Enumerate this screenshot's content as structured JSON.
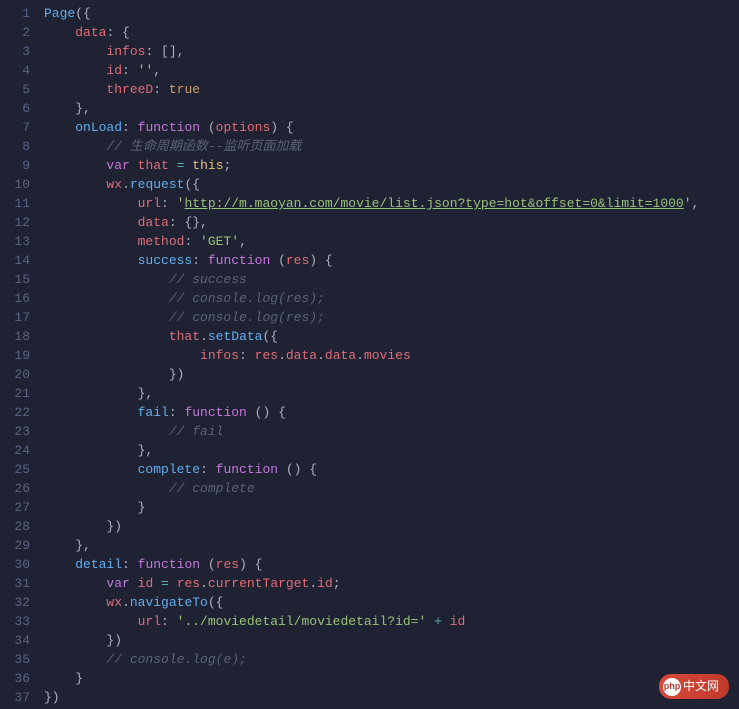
{
  "watermark": "中文网",
  "lines": [
    {
      "n": 1,
      "t": [
        {
          "c": "fn",
          "v": "Page"
        },
        {
          "c": "punc",
          "v": "({"
        }
      ]
    },
    {
      "n": 2,
      "t": [
        {
          "c": "",
          "v": "    "
        },
        {
          "c": "prop",
          "v": "data"
        },
        {
          "c": "punc",
          "v": ": {"
        }
      ]
    },
    {
      "n": 3,
      "t": [
        {
          "c": "",
          "v": "        "
        },
        {
          "c": "prop",
          "v": "infos"
        },
        {
          "c": "punc",
          "v": ": [],"
        }
      ]
    },
    {
      "n": 4,
      "t": [
        {
          "c": "",
          "v": "        "
        },
        {
          "c": "prop",
          "v": "id"
        },
        {
          "c": "punc",
          "v": ": "
        },
        {
          "c": "str",
          "v": "''"
        },
        {
          "c": "punc",
          "v": ","
        }
      ]
    },
    {
      "n": 5,
      "t": [
        {
          "c": "",
          "v": "        "
        },
        {
          "c": "prop",
          "v": "threeD"
        },
        {
          "c": "punc",
          "v": ": "
        },
        {
          "c": "bool",
          "v": "true"
        }
      ]
    },
    {
      "n": 6,
      "t": [
        {
          "c": "",
          "v": "    "
        },
        {
          "c": "punc",
          "v": "},"
        }
      ]
    },
    {
      "n": 7,
      "t": [
        {
          "c": "",
          "v": "    "
        },
        {
          "c": "fn",
          "v": "onLoad"
        },
        {
          "c": "punc",
          "v": ": "
        },
        {
          "c": "kw",
          "v": "function"
        },
        {
          "c": "punc",
          "v": " ("
        },
        {
          "c": "param",
          "v": "options"
        },
        {
          "c": "punc",
          "v": ") {"
        }
      ]
    },
    {
      "n": 8,
      "t": [
        {
          "c": "",
          "v": "        "
        },
        {
          "c": "comment",
          "v": "// 生命周期函数--监听页面加载"
        }
      ]
    },
    {
      "n": 9,
      "t": [
        {
          "c": "",
          "v": "        "
        },
        {
          "c": "kw",
          "v": "var"
        },
        {
          "c": "",
          "v": " "
        },
        {
          "c": "id",
          "v": "that"
        },
        {
          "c": "",
          "v": " "
        },
        {
          "c": "op",
          "v": "="
        },
        {
          "c": "",
          "v": " "
        },
        {
          "c": "this",
          "v": "this"
        },
        {
          "c": "punc",
          "v": ";"
        }
      ]
    },
    {
      "n": 10,
      "t": [
        {
          "c": "",
          "v": "        "
        },
        {
          "c": "id",
          "v": "wx"
        },
        {
          "c": "punc",
          "v": "."
        },
        {
          "c": "fn",
          "v": "request"
        },
        {
          "c": "punc",
          "v": "({"
        }
      ]
    },
    {
      "n": 11,
      "t": [
        {
          "c": "",
          "v": "            "
        },
        {
          "c": "prop",
          "v": "url"
        },
        {
          "c": "punc",
          "v": ": "
        },
        {
          "c": "str",
          "v": "'"
        },
        {
          "c": "str-u",
          "v": "http://m.maoyan.com/movie/list.json?type=hot&offset=0&limit=1000"
        },
        {
          "c": "str",
          "v": "'"
        },
        {
          "c": "punc",
          "v": ","
        }
      ]
    },
    {
      "n": 12,
      "t": [
        {
          "c": "",
          "v": "            "
        },
        {
          "c": "prop",
          "v": "data"
        },
        {
          "c": "punc",
          "v": ": {},"
        }
      ]
    },
    {
      "n": 13,
      "t": [
        {
          "c": "",
          "v": "            "
        },
        {
          "c": "prop",
          "v": "method"
        },
        {
          "c": "punc",
          "v": ": "
        },
        {
          "c": "str",
          "v": "'GET'"
        },
        {
          "c": "punc",
          "v": ","
        }
      ]
    },
    {
      "n": 14,
      "t": [
        {
          "c": "",
          "v": "            "
        },
        {
          "c": "fn",
          "v": "success"
        },
        {
          "c": "punc",
          "v": ": "
        },
        {
          "c": "kw",
          "v": "function"
        },
        {
          "c": "punc",
          "v": " ("
        },
        {
          "c": "param",
          "v": "res"
        },
        {
          "c": "punc",
          "v": ") {"
        }
      ]
    },
    {
      "n": 15,
      "t": [
        {
          "c": "",
          "v": "                "
        },
        {
          "c": "comment",
          "v": "// success"
        }
      ]
    },
    {
      "n": 16,
      "t": [
        {
          "c": "",
          "v": "                "
        },
        {
          "c": "comment",
          "v": "// console.log(res);"
        }
      ]
    },
    {
      "n": 17,
      "t": [
        {
          "c": "",
          "v": "                "
        },
        {
          "c": "comment",
          "v": "// console.log(res);"
        }
      ]
    },
    {
      "n": 18,
      "t": [
        {
          "c": "",
          "v": "                "
        },
        {
          "c": "id",
          "v": "that"
        },
        {
          "c": "punc",
          "v": "."
        },
        {
          "c": "fn",
          "v": "setData"
        },
        {
          "c": "punc",
          "v": "({"
        }
      ]
    },
    {
      "n": 19,
      "t": [
        {
          "c": "",
          "v": "                    "
        },
        {
          "c": "prop",
          "v": "infos"
        },
        {
          "c": "punc",
          "v": ": "
        },
        {
          "c": "id",
          "v": "res"
        },
        {
          "c": "punc",
          "v": "."
        },
        {
          "c": "id",
          "v": "data"
        },
        {
          "c": "punc",
          "v": "."
        },
        {
          "c": "id",
          "v": "data"
        },
        {
          "c": "punc",
          "v": "."
        },
        {
          "c": "id",
          "v": "movies"
        }
      ]
    },
    {
      "n": 20,
      "t": [
        {
          "c": "",
          "v": "                "
        },
        {
          "c": "punc",
          "v": "})"
        }
      ]
    },
    {
      "n": 21,
      "t": [
        {
          "c": "",
          "v": "            "
        },
        {
          "c": "punc",
          "v": "},"
        }
      ]
    },
    {
      "n": 22,
      "t": [
        {
          "c": "",
          "v": "            "
        },
        {
          "c": "fn",
          "v": "fail"
        },
        {
          "c": "punc",
          "v": ": "
        },
        {
          "c": "kw",
          "v": "function"
        },
        {
          "c": "punc",
          "v": " () {"
        }
      ]
    },
    {
      "n": 23,
      "t": [
        {
          "c": "",
          "v": "                "
        },
        {
          "c": "comment",
          "v": "// fail"
        }
      ]
    },
    {
      "n": 24,
      "t": [
        {
          "c": "",
          "v": "            "
        },
        {
          "c": "punc",
          "v": "},"
        }
      ]
    },
    {
      "n": 25,
      "t": [
        {
          "c": "",
          "v": "            "
        },
        {
          "c": "fn",
          "v": "complete"
        },
        {
          "c": "punc",
          "v": ": "
        },
        {
          "c": "kw",
          "v": "function"
        },
        {
          "c": "punc",
          "v": " () {"
        }
      ]
    },
    {
      "n": 26,
      "t": [
        {
          "c": "",
          "v": "                "
        },
        {
          "c": "comment",
          "v": "// complete"
        }
      ]
    },
    {
      "n": 27,
      "t": [
        {
          "c": "",
          "v": "            "
        },
        {
          "c": "punc",
          "v": "}"
        }
      ]
    },
    {
      "n": 28,
      "t": [
        {
          "c": "",
          "v": "        "
        },
        {
          "c": "punc",
          "v": "})"
        }
      ]
    },
    {
      "n": 29,
      "t": [
        {
          "c": "",
          "v": "    "
        },
        {
          "c": "punc",
          "v": "},"
        }
      ]
    },
    {
      "n": 30,
      "t": [
        {
          "c": "",
          "v": "    "
        },
        {
          "c": "fn",
          "v": "detail"
        },
        {
          "c": "punc",
          "v": ": "
        },
        {
          "c": "kw",
          "v": "function"
        },
        {
          "c": "punc",
          "v": " ("
        },
        {
          "c": "param",
          "v": "res"
        },
        {
          "c": "punc",
          "v": ") {"
        }
      ]
    },
    {
      "n": 31,
      "t": [
        {
          "c": "",
          "v": "        "
        },
        {
          "c": "kw",
          "v": "var"
        },
        {
          "c": "",
          "v": " "
        },
        {
          "c": "id",
          "v": "id"
        },
        {
          "c": "",
          "v": " "
        },
        {
          "c": "op",
          "v": "="
        },
        {
          "c": "",
          "v": " "
        },
        {
          "c": "id",
          "v": "res"
        },
        {
          "c": "punc",
          "v": "."
        },
        {
          "c": "id",
          "v": "currentTarget"
        },
        {
          "c": "punc",
          "v": "."
        },
        {
          "c": "id",
          "v": "id"
        },
        {
          "c": "punc",
          "v": ";"
        }
      ]
    },
    {
      "n": 32,
      "t": [
        {
          "c": "",
          "v": "        "
        },
        {
          "c": "id",
          "v": "wx"
        },
        {
          "c": "punc",
          "v": "."
        },
        {
          "c": "fn",
          "v": "navigateTo"
        },
        {
          "c": "punc",
          "v": "({"
        }
      ]
    },
    {
      "n": 33,
      "t": [
        {
          "c": "",
          "v": "            "
        },
        {
          "c": "prop",
          "v": "url"
        },
        {
          "c": "punc",
          "v": ": "
        },
        {
          "c": "str",
          "v": "'../moviedetail/moviedetail?id='"
        },
        {
          "c": "",
          "v": " "
        },
        {
          "c": "op",
          "v": "+"
        },
        {
          "c": "",
          "v": " "
        },
        {
          "c": "id",
          "v": "id"
        }
      ]
    },
    {
      "n": 34,
      "t": [
        {
          "c": "",
          "v": "        "
        },
        {
          "c": "punc",
          "v": "})"
        }
      ]
    },
    {
      "n": 35,
      "t": [
        {
          "c": "",
          "v": "        "
        },
        {
          "c": "comment",
          "v": "// console.log(e);"
        }
      ]
    },
    {
      "n": 36,
      "t": [
        {
          "c": "",
          "v": "    "
        },
        {
          "c": "punc",
          "v": "}"
        }
      ]
    },
    {
      "n": 37,
      "t": [
        {
          "c": "punc",
          "v": "})"
        }
      ]
    }
  ]
}
